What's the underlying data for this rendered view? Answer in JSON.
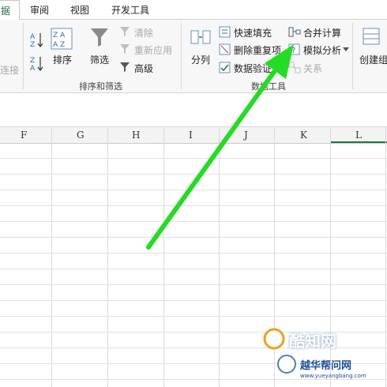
{
  "tabs": {
    "active": "据",
    "items": [
      "审阅",
      "视图",
      "开发工具"
    ]
  },
  "ribbon": {
    "left_partial": "连接",
    "sort_filter": {
      "sort_label": "排序",
      "filter_label": "筛选",
      "clear_label": "清除",
      "reapply_label": "重新应用",
      "advanced_label": "高级",
      "group_label": "排序和筛选"
    },
    "data_tools": {
      "split_label": "分列",
      "flash_fill_label": "快速填充",
      "remove_dup_label": "删除重复项",
      "validation_label": "数据验证",
      "consolidate_label": "合并计算",
      "whatif_label": "模拟分析",
      "relation_label": "关系",
      "group_label": "数据工具"
    },
    "outline": {
      "group_create_label": "创建组"
    }
  },
  "columns": [
    "F",
    "G",
    "H",
    "I",
    "J",
    "K",
    "L"
  ],
  "watermark": {
    "main": "酷知网",
    "sub": "越华帮问网",
    "url": "www.yueyangbang.com"
  },
  "colors": {
    "accent": "#217346",
    "arrow": "#22dd22"
  }
}
